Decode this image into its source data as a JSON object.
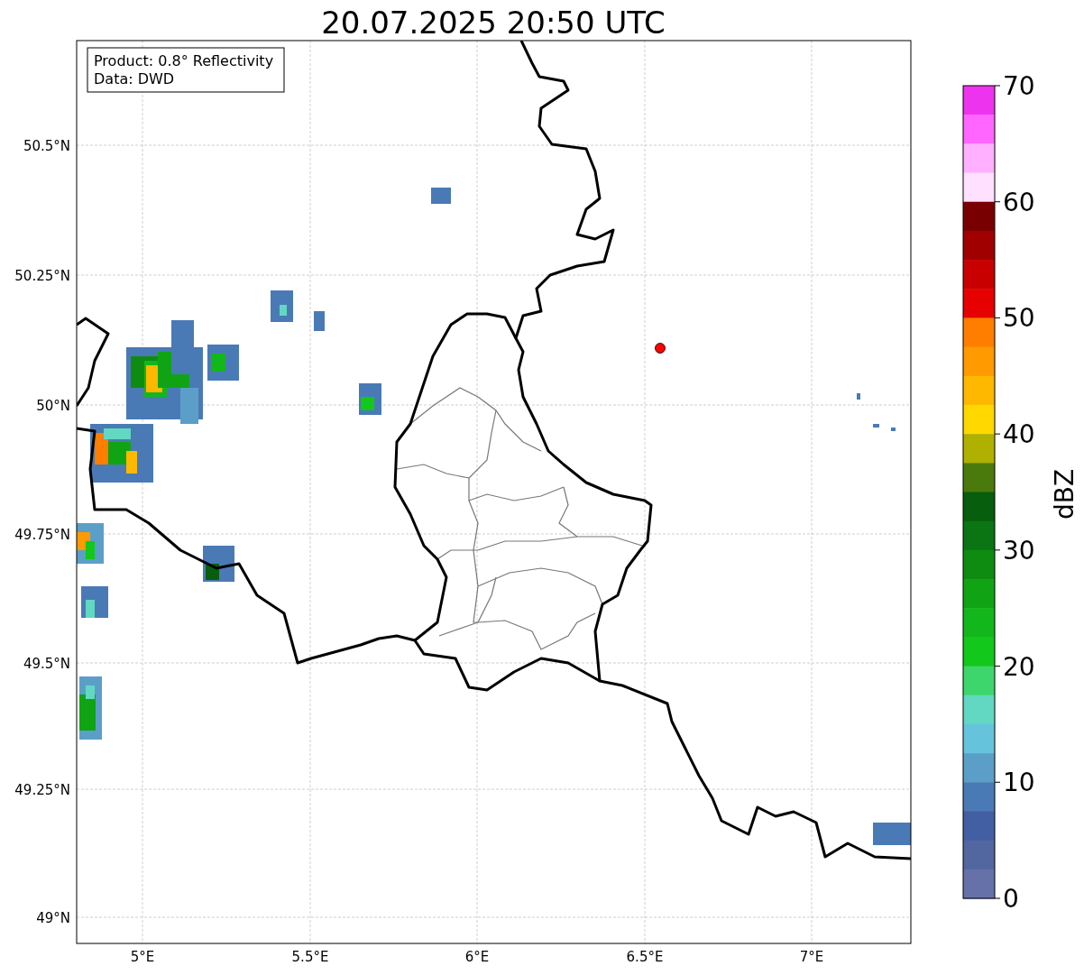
{
  "title": "20.07.2025 20:50 UTC",
  "info_box": {
    "lines": [
      "Product: 0.8° Reflectivity",
      "Data: DWD"
    ]
  },
  "map": {
    "lat_labels": [
      "50.5°N",
      "50.25°N",
      "50°N",
      "49.75°N",
      "49.5°N",
      "49.25°N",
      "49°N"
    ],
    "lon_labels": [
      "5°E",
      "5.5°E",
      "6°E",
      "6.5°E",
      "7°E"
    ]
  },
  "colorbar": {
    "label": "dBZ",
    "ticks": [
      "70",
      "60",
      "50",
      "40",
      "30",
      "20",
      "10",
      "0"
    ],
    "bands": [
      {
        "color": "#ee33ee"
      },
      {
        "color": "#ff66ff"
      },
      {
        "color": "#ffb0ff"
      },
      {
        "color": "#ffe0ff"
      },
      {
        "color": "#780000"
      },
      {
        "color": "#a00000"
      },
      {
        "color": "#c80000"
      },
      {
        "color": "#e60000"
      },
      {
        "color": "#ff7e00"
      },
      {
        "color": "#ff9a00"
      },
      {
        "color": "#ffb800"
      },
      {
        "color": "#ffd800"
      },
      {
        "color": "#b0b000"
      },
      {
        "color": "#4a7a0c"
      },
      {
        "color": "#075e0c"
      },
      {
        "color": "#0a7512"
      },
      {
        "color": "#0e8c12"
      },
      {
        "color": "#10a414"
      },
      {
        "color": "#12b81b"
      },
      {
        "color": "#12c81a"
      },
      {
        "color": "#3dd66c"
      },
      {
        "color": "#62d8c2"
      },
      {
        "color": "#66c3dc"
      },
      {
        "color": "#5b9fc8"
      },
      {
        "color": "#4a7ab5"
      },
      {
        "color": "#435fa3"
      },
      {
        "color": "#5266a0"
      },
      {
        "color": "#6571a8"
      }
    ]
  }
}
